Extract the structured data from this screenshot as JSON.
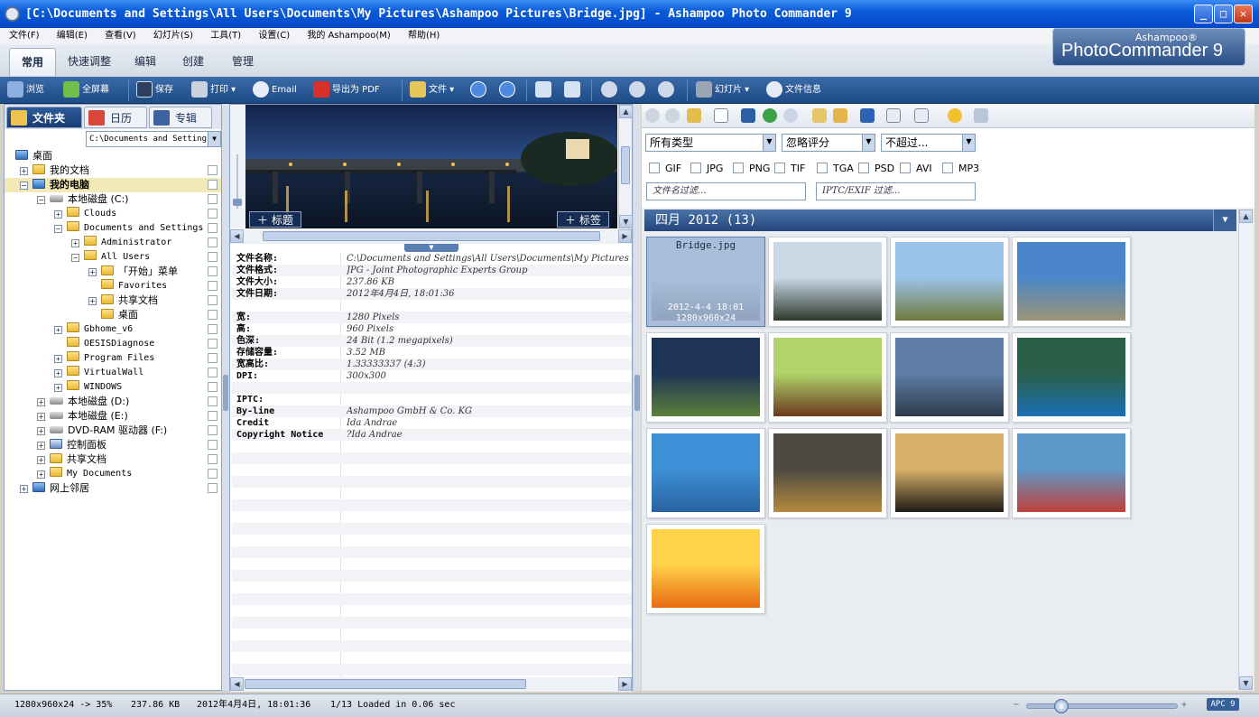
{
  "window": {
    "title": "[C:\\Documents and Settings\\All Users\\Documents\\My Pictures\\Ashampoo Pictures\\Bridge.jpg] - Ashampoo Photo Commander 9",
    "min": "_",
    "max": "□",
    "close": "✕"
  },
  "menu": [
    "文件(F)",
    "编辑(E)",
    "查看(V)",
    "幻灯片(S)",
    "工具(T)",
    "设置(C)",
    "我的 Ashampoo(M)",
    "帮助(H)"
  ],
  "ribbon_tabs": [
    "常用",
    "快速调整",
    "编辑",
    "创建",
    "管理"
  ],
  "brand": {
    "line1": "Ashampoo®",
    "line2": "PhotoCommander 9"
  },
  "toolbar": {
    "browse": "浏览",
    "fullscreen": "全屏幕",
    "save": "保存",
    "print": "打印",
    "email": "Email",
    "export_pdf": "导出为 PDF",
    "file": "文件",
    "slideshow": "幻灯片",
    "fileinfo": "文件信息"
  },
  "left": {
    "tabs": [
      "文件夹",
      "日历",
      "专辑"
    ],
    "path": "C:\\Documents and Settings",
    "tree": [
      {
        "label": "桌面",
        "indent": 0,
        "icon": "desktop-icon",
        "exp": ""
      },
      {
        "label": "我的文档",
        "indent": 1,
        "icon": "folder-icon",
        "exp": "+"
      },
      {
        "label": "我的电脑",
        "indent": 1,
        "icon": "computer-icon",
        "exp": "-",
        "bold": true,
        "selected": true
      },
      {
        "label": "本地磁盘 (C:)",
        "indent": 2,
        "icon": "drive-icon",
        "exp": "-"
      },
      {
        "label": "Clouds",
        "indent": 3,
        "icon": "folder-icon",
        "exp": "+",
        "mono": true
      },
      {
        "label": "Documents and Settings",
        "indent": 3,
        "icon": "folder-icon",
        "exp": "-",
        "mono": true
      },
      {
        "label": "Administrator",
        "indent": 4,
        "icon": "folder-icon",
        "exp": "+",
        "mono": true
      },
      {
        "label": "All Users",
        "indent": 4,
        "icon": "folder-icon",
        "exp": "-",
        "mono": true
      },
      {
        "label": "「开始」菜单",
        "indent": 5,
        "icon": "folder-icon",
        "exp": "+"
      },
      {
        "label": "Favorites",
        "indent": 5,
        "icon": "folder-icon",
        "exp": "",
        "mono": true
      },
      {
        "label": "共享文档",
        "indent": 5,
        "icon": "folder-icon",
        "exp": "+"
      },
      {
        "label": "桌面",
        "indent": 5,
        "icon": "folder-icon",
        "exp": ""
      },
      {
        "label": "Gbhome_v6",
        "indent": 3,
        "icon": "folder-icon",
        "exp": "+",
        "mono": true
      },
      {
        "label": "OESISDiagnose",
        "indent": 3,
        "icon": "folder-icon",
        "exp": "",
        "mono": true
      },
      {
        "label": "Program Files",
        "indent": 3,
        "icon": "folder-icon",
        "exp": "+",
        "mono": true
      },
      {
        "label": "VirtualWall",
        "indent": 3,
        "icon": "folder-icon",
        "exp": "+",
        "mono": true
      },
      {
        "label": "WINDOWS",
        "indent": 3,
        "icon": "folder-icon",
        "exp": "+",
        "mono": true
      },
      {
        "label": "本地磁盘 (D:)",
        "indent": 2,
        "icon": "drive-icon",
        "exp": "+"
      },
      {
        "label": "本地磁盘 (E:)",
        "indent": 2,
        "icon": "drive-icon",
        "exp": "+"
      },
      {
        "label": "DVD-RAM 驱动器 (F:)",
        "indent": 2,
        "icon": "dvd-icon",
        "exp": "+"
      },
      {
        "label": "控制面板",
        "indent": 2,
        "icon": "control-panel-icon",
        "exp": "+"
      },
      {
        "label": "共享文档",
        "indent": 2,
        "icon": "folder-icon",
        "exp": "+"
      },
      {
        "label": "My Documents",
        "indent": 2,
        "icon": "folder-icon",
        "exp": "+",
        "mono": true
      },
      {
        "label": "网上邻居",
        "indent": 1,
        "icon": "network-icon",
        "exp": "+"
      }
    ]
  },
  "preview": {
    "title_btn": "标题",
    "tag_btn": "标签"
  },
  "info": [
    {
      "k": "文件名称:",
      "v": "C:\\Documents and Settings\\All Users\\Documents\\My Pictures"
    },
    {
      "k": "文件格式:",
      "v": "JPG - Joint Photographic Experts Group"
    },
    {
      "k": "文件大小:",
      "v": "237.86 KB"
    },
    {
      "k": "文件日期:",
      "v": "2012年4月4日, 18:01:36"
    },
    {
      "k": "",
      "v": ""
    },
    {
      "k": "宽:",
      "v": "1280 Pixels"
    },
    {
      "k": "高:",
      "v": "960 Pixels"
    },
    {
      "k": "色深:",
      "v": "24 Bit (1.2 megapixels)"
    },
    {
      "k": "存储容量:",
      "v": "3.52 MB"
    },
    {
      "k": "宽高比:",
      "v": "1.33333337 (4:3)"
    },
    {
      "k": "DPI:",
      "v": "300x300"
    },
    {
      "k": "",
      "v": ""
    },
    {
      "k": "IPTC:",
      "v": ""
    },
    {
      "k": "By-line",
      "v": "Ashampoo GmbH & Co. KG"
    },
    {
      "k": "Credit",
      "v": "Ida Andrae"
    },
    {
      "k": "Copyright Notice",
      "v": "?Ida Andrae"
    }
  ],
  "filters": {
    "type": "所有类型",
    "rating": "忽略评分",
    "limit": "不超过...",
    "filetypes": [
      "GIF",
      "JPG",
      "PNG",
      "TIF",
      "TGA",
      "PSD",
      "AVI",
      "MP3"
    ],
    "name_placeholder": "文件名过滤...",
    "iptc_placeholder": "IPTC/EXIF 过滤..."
  },
  "group": {
    "title": "四月 2012 (13)"
  },
  "thumbs": [
    {
      "name": "Bridge.jpg",
      "date": "2012-4-4 18:01",
      "dims": "1280x960x24",
      "selected": true,
      "colors": [
        "#a8bfd8",
        "#7d8ea8"
      ]
    },
    {
      "colors": [
        "#c9d9e6",
        "#2f3a2c"
      ]
    },
    {
      "colors": [
        "#9cc4ea",
        "#6f7a3c"
      ]
    },
    {
      "colors": [
        "#4a86c9",
        "#9c9474"
      ]
    },
    {
      "colors": [
        "#1e3456",
        "#5b7f3a"
      ]
    },
    {
      "colors": [
        "#b0d46a",
        "#6b3a1e"
      ]
    },
    {
      "colors": [
        "#5f7fa8",
        "#2c3a4c"
      ]
    },
    {
      "colors": [
        "#2b5f4a",
        "#1a6fb3"
      ]
    },
    {
      "colors": [
        "#3d8fd6",
        "#2a63a0"
      ]
    },
    {
      "colors": [
        "#4c4a42",
        "#b58a3d"
      ]
    },
    {
      "colors": [
        "#d9b16a",
        "#1e1a16"
      ]
    },
    {
      "colors": [
        "#5b98c9",
        "#c1413a"
      ]
    },
    {
      "colors": [
        "#ffd24a",
        "#e86a10"
      ]
    }
  ],
  "status": {
    "dims": "1280x960x24 -> 35%",
    "size": "237.86 KB",
    "date": "2012年4月4日, 18:01:36",
    "loaded": "1/13 Loaded in 0.06 sec",
    "badge": "APC 9",
    "zoom_minus": "−",
    "zoom_plus": "+"
  }
}
